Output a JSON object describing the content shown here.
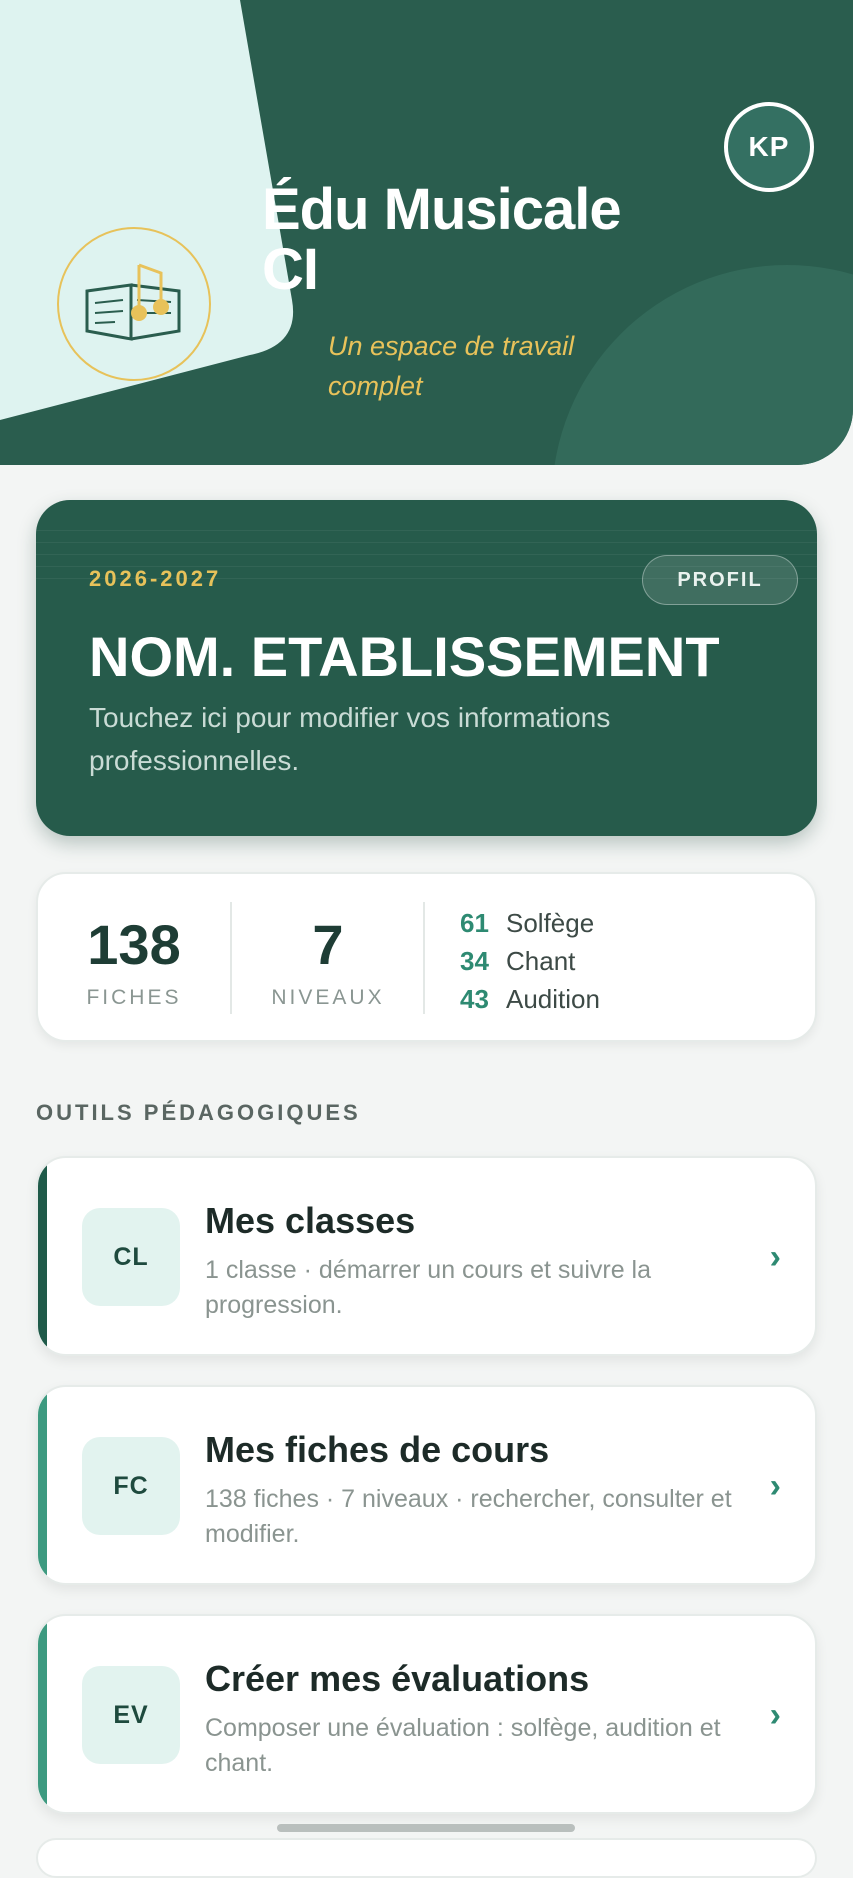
{
  "header": {
    "app_title": "Édu Musicale CI",
    "subtitle": "Un espace de travail complet",
    "avatar_initials": "KP",
    "colors": {
      "dark_green": "#2a5d4e",
      "light_mint": "#def3f0",
      "gold": "#e8c25a"
    },
    "logo_icon": "book-music-note-icon"
  },
  "school": {
    "year": "2026-2027",
    "profile_button": "PROFIL",
    "name": "NOM. ETABLISSEMENT",
    "hint": "Touchez ici pour modifier vos informations professionnelles."
  },
  "stats": {
    "fiches": {
      "value": "138",
      "label": "FICHES"
    },
    "niveaux": {
      "value": "7",
      "label": "NIVEAUX"
    },
    "categories": [
      {
        "count": "61",
        "name": "Solfège"
      },
      {
        "count": "34",
        "name": "Chant"
      },
      {
        "count": "43",
        "name": "Audition"
      }
    ]
  },
  "section": {
    "title": "OUTILS PÉDAGOGIQUES"
  },
  "tools": [
    {
      "abbr": "CL",
      "title": "Mes classes",
      "desc": "1 classe · démarrer un cours et suivre la progression.",
      "accent": "#1f5a49"
    },
    {
      "abbr": "FC",
      "title": "Mes fiches de cours",
      "desc": "138 fiches · 7 niveaux · rechercher, consulter et modifier.",
      "accent": "#3d9a80"
    },
    {
      "abbr": "EV",
      "title": "Créer mes évaluations",
      "desc": "Composer une évaluation : solfège, audition et chant.",
      "accent": "#3d9a80"
    }
  ],
  "chevron": "›"
}
